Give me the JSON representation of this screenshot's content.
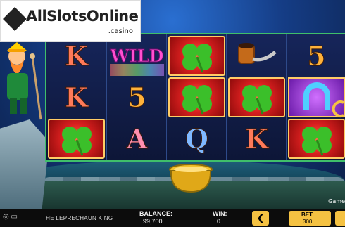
{
  "logo": {
    "brand": "AllSlotsOnline",
    "suffix": ".casino"
  },
  "reels": [
    [
      "K",
      "K",
      "CLOVER"
    ],
    [
      "WILD",
      "5",
      "A"
    ],
    [
      "CLOVER",
      "CLOVER",
      "Q"
    ],
    [
      "PIPE",
      "CLOVER",
      "K"
    ],
    [
      "5",
      "HORSESHOE",
      "CLOVER"
    ]
  ],
  "labels": {
    "k": "K",
    "a": "A",
    "q": "Q",
    "five": "5",
    "wild": "WILD"
  },
  "side": {
    "game_label": "Game"
  },
  "hud": {
    "game_title": "THE LEPRECHAUN KING",
    "balance_label": "BALANCE:",
    "balance_value": "99,700",
    "win_label": "WIN:",
    "win_value": "0",
    "bet_label": "BET:",
    "bet_value": "300",
    "prev_arrow": "❮"
  },
  "colors": {
    "accent": "#f5c242",
    "frame": "#3fbf6a"
  }
}
